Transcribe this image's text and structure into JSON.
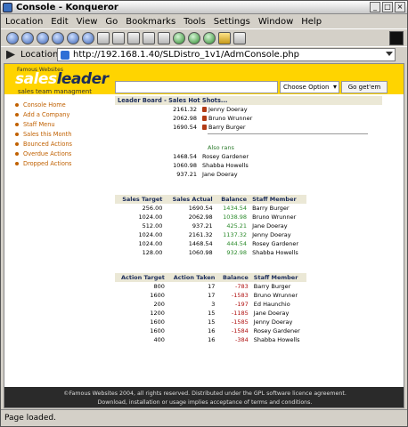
{
  "window": {
    "title": "Console - Konqueror"
  },
  "menu": [
    "Location",
    "Edit",
    "View",
    "Go",
    "Bookmarks",
    "Tools",
    "Settings",
    "Window",
    "Help"
  ],
  "location": {
    "label": "Location:",
    "url": "http://192.168.1.40/SLDistro_1v1/AdmConsole.php"
  },
  "header": {
    "logo_tagline": "Famous Websites",
    "logo_text_a": "sales",
    "logo_text_b": "leader",
    "logo_sub": "sales team managment",
    "search_value": "",
    "select_label": "Choose Option",
    "go_label": "Go get'em"
  },
  "sidebar": [
    "Console Home",
    "Add a Company",
    "Staff Menu",
    "Sales this Month",
    "Bounced Actions",
    "Overdue Actions",
    "Dropped Actions"
  ],
  "leaderboard": {
    "title": "Leader Board - Sales Hot Shots...",
    "top": [
      {
        "value": "2161.32",
        "name": "Jenny Doeray"
      },
      {
        "value": "2062.98",
        "name": "Bruno Wrunner"
      },
      {
        "value": "1690.54",
        "name": "Barry Burger"
      }
    ],
    "also_label": "Also rans",
    "also": [
      {
        "value": "1468.54",
        "name": "Rosey Gardener"
      },
      {
        "value": "1060.98",
        "name": "Shabba Howells"
      },
      {
        "value": "937.21",
        "name": "Jane Doeray"
      }
    ]
  },
  "sales_table": {
    "headers": [
      "Sales Target",
      "Sales Actual",
      "Balance",
      "Staff Member"
    ],
    "rows": [
      [
        "256.00",
        "1690.54",
        "1434.54",
        "Barry Burger"
      ],
      [
        "1024.00",
        "2062.98",
        "1038.98",
        "Bruno Wrunner"
      ],
      [
        "512.00",
        "937.21",
        "425.21",
        "Jane Doeray"
      ],
      [
        "1024.00",
        "2161.32",
        "1137.32",
        "Jenny Doeray"
      ],
      [
        "1024.00",
        "1468.54",
        "444.54",
        "Rosey Gardener"
      ],
      [
        "128.00",
        "1060.98",
        "932.98",
        "Shabba Howells"
      ]
    ]
  },
  "action_table": {
    "headers": [
      "Action Target",
      "Action Taken",
      "Balance",
      "Staff Member"
    ],
    "rows": [
      [
        "800",
        "17",
        "-783",
        "Barry Burger"
      ],
      [
        "1600",
        "17",
        "-1583",
        "Bruno Wrunner"
      ],
      [
        "200",
        "3",
        "-197",
        "Ed Haunchio"
      ],
      [
        "1200",
        "15",
        "-1185",
        "Jane Doeray"
      ],
      [
        "1600",
        "15",
        "-1585",
        "Jenny Doeray"
      ],
      [
        "1600",
        "16",
        "-1584",
        "Rosey Gardener"
      ],
      [
        "400",
        "16",
        "-384",
        "Shabba Howells"
      ]
    ]
  },
  "footer": {
    "line1": "©Famous Websites 2004, all rights reserved. Distributed under the GPL software licence agreement.",
    "line2": "Download, installation or usage implies acceptance of terms and conditions."
  },
  "status": "Page loaded.",
  "colors": {
    "accent_yellow": "#ffd400",
    "link_orange": "#c06000",
    "positive_green": "#2b8a2b",
    "negative_red": "#b01010"
  }
}
